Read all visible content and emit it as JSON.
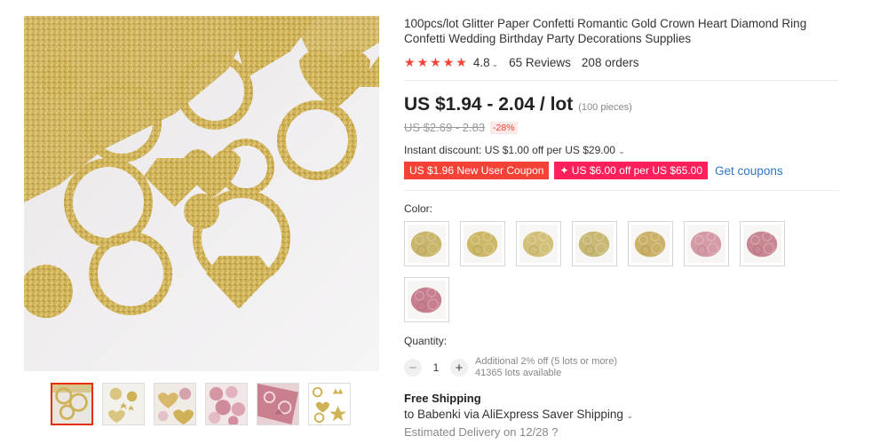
{
  "product": {
    "title": "100pcs/lot Glitter Paper Confetti Romantic Gold Crown Heart Diamond Ring Confetti Wedding Birthday Party Decorations Supplies",
    "rating": "4.8",
    "reviews": "65 Reviews",
    "orders": "208 orders"
  },
  "price": {
    "current": "US $1.94 - 2.04 / lot",
    "pieces": "(100 pieces)",
    "original": "US $2.69 - 2.83",
    "discount": "-28%"
  },
  "discounts": {
    "instant": "Instant discount: US $1.00 off per US $29.00",
    "coupon_new_user": "US $1.96 New User Coupon",
    "coupon_store": "✦ US $6.00 off per US $65.00",
    "get_coupons": "Get coupons"
  },
  "color": {
    "label": "Color:",
    "swatches": [
      {
        "name": "gold-1",
        "color": "#c9b56b"
      },
      {
        "name": "gold-2",
        "color": "#cdb868"
      },
      {
        "name": "gold-3",
        "color": "#d1c078"
      },
      {
        "name": "gold-4",
        "color": "#c7b874"
      },
      {
        "name": "gold-5",
        "color": "#cbb06a"
      },
      {
        "name": "pink-1",
        "color": "#d49aa6"
      },
      {
        "name": "pink-2",
        "color": "#c88592"
      },
      {
        "name": "pink-3",
        "color": "#c77f8f"
      }
    ]
  },
  "quantity": {
    "label": "Quantity:",
    "value": "1",
    "note1": "Additional 2% off (5 lots or more)",
    "note2": "41365 lots available"
  },
  "shipping": {
    "title": "Free Shipping",
    "line": "to Babenki via AliExpress Saver Shipping",
    "delivery": "Estimated Delivery on 12/28"
  },
  "colors": {
    "accent": "#f44336",
    "coupon_pink": "#ff1f5a",
    "link": "#2f78c5"
  }
}
